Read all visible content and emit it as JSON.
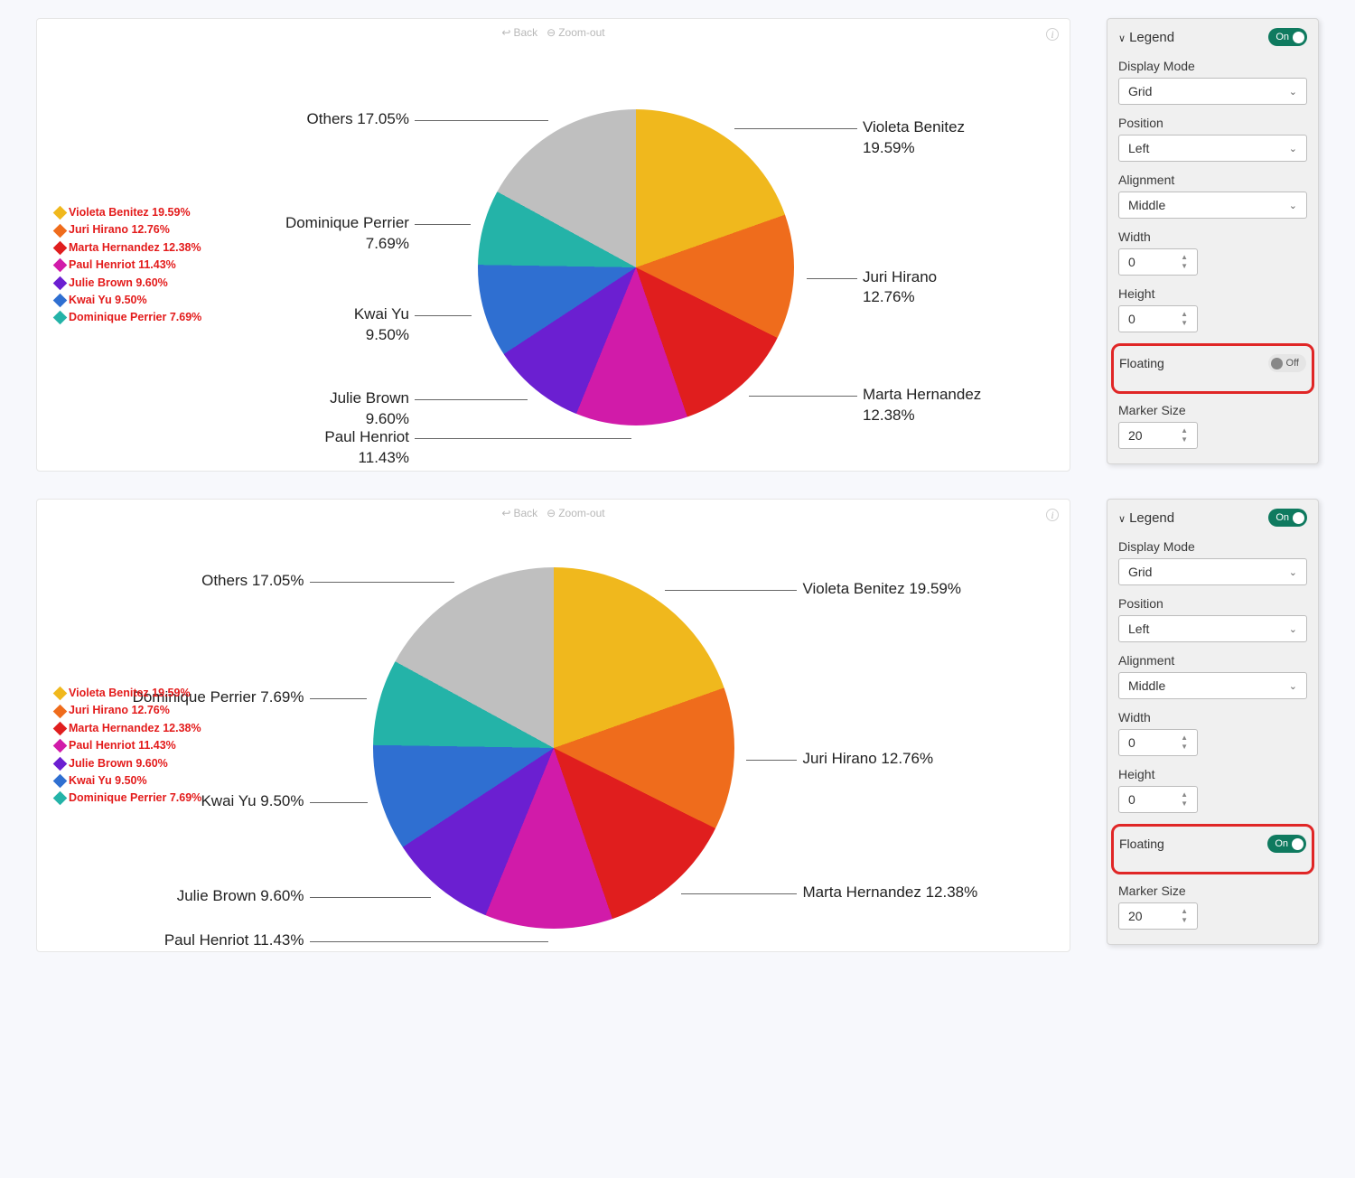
{
  "chart_data": [
    {
      "type": "pie",
      "title": "",
      "slices": [
        {
          "name": "Violeta Benitez",
          "pct": 19.59,
          "color": "#f0b81d"
        },
        {
          "name": "Juri Hirano",
          "pct": 12.76,
          "color": "#ef6c1c"
        },
        {
          "name": "Marta Hernandez",
          "pct": 12.38,
          "color": "#e01e1e"
        },
        {
          "name": "Paul Henriot",
          "pct": 11.43,
          "color": "#d11ba9"
        },
        {
          "name": "Julie Brown",
          "pct": 9.6,
          "color": "#6b1fd1"
        },
        {
          "name": "Kwai Yu",
          "pct": 9.5,
          "color": "#2f6fd1"
        },
        {
          "name": "Dominique Perrier",
          "pct": 7.69,
          "color": "#24b3a8"
        },
        {
          "name": "Others",
          "pct": 17.05,
          "color": "#bfbfbf"
        }
      ],
      "legend_items": [
        {
          "text": "Violeta Benitez 19.59%",
          "color": "#f0b81d"
        },
        {
          "text": "Juri Hirano 12.76%",
          "color": "#ef6c1c"
        },
        {
          "text": "Marta Hernandez 12.38%",
          "color": "#e01e1e"
        },
        {
          "text": "Paul Henriot 11.43%",
          "color": "#d11ba9"
        },
        {
          "text": "Julie Brown 9.60%",
          "color": "#6b1fd1"
        },
        {
          "text": "Kwai Yu 9.50%",
          "color": "#2f6fd1"
        },
        {
          "text": "Dominique Perrier 7.69%",
          "color": "#24b3a8"
        }
      ]
    },
    {
      "type": "pie",
      "title": "",
      "slices": [
        {
          "name": "Violeta Benitez",
          "pct": 19.59,
          "color": "#f0b81d"
        },
        {
          "name": "Juri Hirano",
          "pct": 12.76,
          "color": "#ef6c1c"
        },
        {
          "name": "Marta Hernandez",
          "pct": 12.38,
          "color": "#e01e1e"
        },
        {
          "name": "Paul Henriot",
          "pct": 11.43,
          "color": "#d11ba9"
        },
        {
          "name": "Julie Brown",
          "pct": 9.6,
          "color": "#6b1fd1"
        },
        {
          "name": "Kwai Yu",
          "pct": 9.5,
          "color": "#2f6fd1"
        },
        {
          "name": "Dominique Perrier",
          "pct": 7.69,
          "color": "#24b3a8"
        },
        {
          "name": "Others",
          "pct": 17.05,
          "color": "#bfbfbf"
        }
      ],
      "legend_items": [
        {
          "text": "Violeta Benitez 19.59%",
          "color": "#f0b81d"
        },
        {
          "text": "Juri Hirano 12.76%",
          "color": "#ef6c1c"
        },
        {
          "text": "Marta Hernandez 12.38%",
          "color": "#e01e1e"
        },
        {
          "text": "Paul Henriot 11.43%",
          "color": "#d11ba9"
        },
        {
          "text": "Julie Brown 9.60%",
          "color": "#6b1fd1"
        },
        {
          "text": "Kwai Yu 9.50%",
          "color": "#2f6fd1"
        },
        {
          "text": "Dominique Perrier 7.69%",
          "color": "#24b3a8"
        }
      ]
    }
  ],
  "toolbar": {
    "back": "Back",
    "zoom_out": "Zoom-out"
  },
  "panels": [
    {
      "title": "Legend",
      "main_toggle": "On",
      "fields": {
        "display_mode_label": "Display Mode",
        "display_mode_value": "Grid",
        "position_label": "Position",
        "position_value": "Left",
        "alignment_label": "Alignment",
        "alignment_value": "Middle",
        "width_label": "Width",
        "width_value": "0",
        "height_label": "Height",
        "height_value": "0",
        "floating_label": "Floating",
        "floating_value": "Off",
        "marker_label": "Marker Size",
        "marker_value": "20"
      }
    },
    {
      "title": "Legend",
      "main_toggle": "On",
      "fields": {
        "display_mode_label": "Display Mode",
        "display_mode_value": "Grid",
        "position_label": "Position",
        "position_value": "Left",
        "alignment_label": "Alignment",
        "alignment_value": "Middle",
        "width_label": "Width",
        "width_value": "0",
        "height_label": "Height",
        "height_value": "0",
        "floating_label": "Floating",
        "floating_value": "On",
        "marker_label": "Marker Size",
        "marker_value": "20"
      }
    }
  ]
}
